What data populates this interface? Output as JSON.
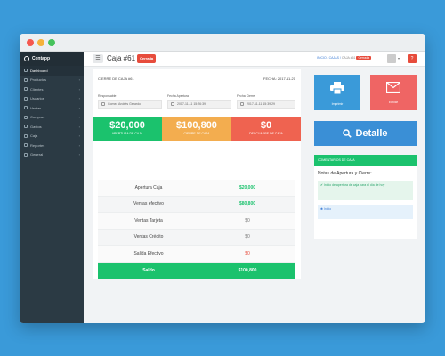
{
  "sidebar": {
    "brand": "Centapp",
    "items": [
      {
        "label": "Dashboard",
        "active": true,
        "chevron": false
      },
      {
        "label": "Productos",
        "chevron": true
      },
      {
        "label": "Clientes",
        "chevron": true
      },
      {
        "label": "Usuarios",
        "chevron": true
      },
      {
        "label": "Ventas",
        "chevron": true
      },
      {
        "label": "Compras",
        "chevron": true
      },
      {
        "label": "Gastos",
        "chevron": true
      },
      {
        "label": "Caja",
        "chevron": true
      },
      {
        "label": "Reportes",
        "chevron": true
      },
      {
        "label": "General",
        "chevron": true
      }
    ]
  },
  "topbar": {
    "menu_icon": "☰",
    "title": "Caja #61",
    "status_badge": "Cerrada",
    "breadcrumb": {
      "home": "INICIO",
      "sep": "/",
      "section": "CAJAS",
      "current": "CAJA #61",
      "current_badge": "Cerrada"
    },
    "help_label": "?"
  },
  "main": {
    "card_title": "CIERRE DE CAJA #61",
    "card_date": "FECHA: 2017-11-21",
    "fields": {
      "responsable_label": "Responsable",
      "responsable_value": "Gomez Andrés Gerardo",
      "apertura_label": "Fecha Apertura",
      "apertura_value": "2017-11-11 15:26:39",
      "cierre_label": "Fecha Cierre",
      "cierre_value": "2017-11-11 15:39:29"
    },
    "tiles": [
      {
        "amount": "$20,000",
        "label": "APERTURA DE CAJA"
      },
      {
        "amount": "$100,800",
        "label": "CIERRE DE CAJA"
      },
      {
        "amount": "$0",
        "label": "DESCUADRE DE CAJA"
      }
    ],
    "summary": [
      {
        "label": "Apertura Caja",
        "value": "$20,000"
      },
      {
        "label": "Ventas efectivo",
        "value": "$80,800"
      },
      {
        "label": "Ventas Tarjeta",
        "value": "$0"
      },
      {
        "label": "Ventas Crédito",
        "value": "$0"
      },
      {
        "label": "Salida Efectivo",
        "value": "$0"
      }
    ],
    "total": {
      "label": "Saldo",
      "value": "$100,800"
    }
  },
  "actions": {
    "print_label": "Imprimir",
    "email_label": "Enviar",
    "detail_label": "Detalle"
  },
  "notes": {
    "header": "COMENTARIOS DE CAJA",
    "title": "Notas de Apertura y Cierre:",
    "note_open": "Inicio de apertura de caja para el día de hoy",
    "note_close": "Inicio"
  },
  "colors": {
    "green": "#1bc26d",
    "orange": "#f3ad4f",
    "red": "#ef6350",
    "blue": "#3a9ad9",
    "pink": "#ef6564"
  }
}
